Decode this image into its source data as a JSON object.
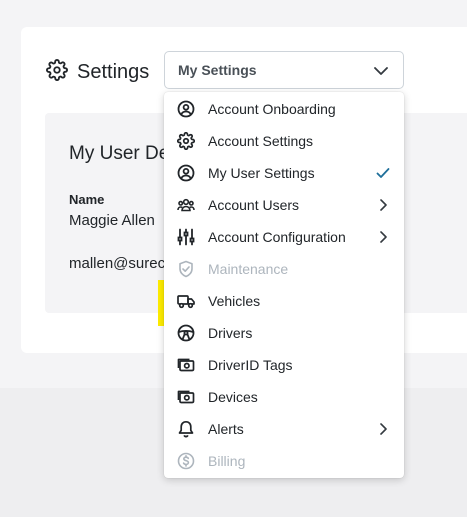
{
  "header": {
    "title": "Settings",
    "icon": "gear-icon"
  },
  "select": {
    "value": "My Settings"
  },
  "panel": {
    "title": "My User De",
    "name_label": "Name",
    "name_value": "Maggie Allen",
    "email_value": "mallen@surec"
  },
  "menu": {
    "items": [
      {
        "label": "Account Onboarding",
        "icon": "user-circle-icon",
        "disabled": false,
        "trail": ""
      },
      {
        "label": "Account Settings",
        "icon": "gear-icon",
        "disabled": false,
        "trail": ""
      },
      {
        "label": "My User Settings",
        "icon": "user-circle-icon",
        "disabled": false,
        "trail": "check"
      },
      {
        "label": "Account Users",
        "icon": "users-icon",
        "disabled": false,
        "trail": "chevron"
      },
      {
        "label": "Account Configuration",
        "icon": "sliders-icon",
        "disabled": false,
        "trail": "chevron"
      },
      {
        "label": "Maintenance",
        "icon": "shield-check-icon",
        "disabled": true,
        "trail": ""
      },
      {
        "label": "Vehicles",
        "icon": "truck-icon",
        "disabled": false,
        "trail": ""
      },
      {
        "label": "Drivers",
        "icon": "steering-wheel-icon",
        "disabled": false,
        "trail": ""
      },
      {
        "label": "DriverID Tags",
        "icon": "id-tag-icon",
        "disabled": false,
        "trail": ""
      },
      {
        "label": "Devices",
        "icon": "device-icon",
        "disabled": false,
        "trail": ""
      },
      {
        "label": "Alerts",
        "icon": "bell-icon",
        "disabled": false,
        "trail": "chevron"
      },
      {
        "label": "Billing",
        "icon": "dollar-circle-icon",
        "disabled": true,
        "trail": ""
      }
    ]
  },
  "colors": {
    "check": "#1f6f9a",
    "highlight": "#ffee00",
    "disabled": "#adb5bd"
  }
}
